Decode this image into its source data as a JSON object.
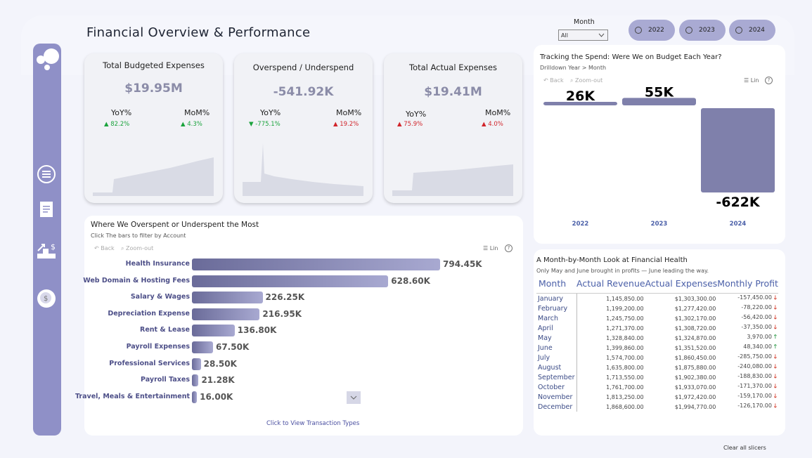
{
  "page_title": "Financial Overview & Performance",
  "month_slicer": {
    "label": "Month",
    "value": "All"
  },
  "year_buttons": [
    "2022",
    "2023",
    "2024"
  ],
  "kpis": [
    {
      "title": "Total Budgeted Expenses",
      "value": "$19.95M",
      "yoy_label": "YoY%",
      "yoy": "▲ 82.2%",
      "mom_label": "MoM%",
      "mom": "▲ 4.3%"
    },
    {
      "title": "Overspend / Underspend",
      "value": "-541.92K",
      "yoy_label": "YoY%",
      "yoy": "▼ -775.1%",
      "mom_label": "MoM%",
      "mom": "▲ 19.2%"
    },
    {
      "title": "Total Actual Expenses",
      "value": "$19.41M",
      "yoy_label": "YoY%",
      "yoy": "▲ 75.9%",
      "mom_label": "MoM%",
      "mom": "▲ 4.0%"
    }
  ],
  "budget_chart": {
    "title": "Tracking the Spend: Were We on Budget Each Year?",
    "breadcrumb": "Drilldown Year > Month",
    "back": "Back",
    "zoom_out": "Zoom-out",
    "lin": "Lin"
  },
  "overspend_chart": {
    "title": "Where We Overspent or Underspent the Most",
    "subtitle": "Click The bars to filter by Account",
    "back": "Back",
    "zoom_out": "Zoom-out",
    "lin": "Lin",
    "footer_link": "Click to View Transaction Types"
  },
  "month_table": {
    "title": "A Month-by-Month Look at Financial Health",
    "subtitle": "Only May and June brought in profits — June leading the way.",
    "columns": [
      "Month",
      "Actual Revenue",
      "Actual Expenses",
      "Monthly Profit"
    ],
    "rows": [
      {
        "month": "January",
        "revenue": "1,145,850.00",
        "expenses": "$1,303,300.00",
        "profit": "-157,450.00",
        "dir": "down"
      },
      {
        "month": "February",
        "revenue": "1,199,200.00",
        "expenses": "$1,277,420.00",
        "profit": "-78,220.00",
        "dir": "down"
      },
      {
        "month": "March",
        "revenue": "1,245,750.00",
        "expenses": "$1,302,170.00",
        "profit": "-56,420.00",
        "dir": "down"
      },
      {
        "month": "April",
        "revenue": "1,271,370.00",
        "expenses": "$1,308,720.00",
        "profit": "-37,350.00",
        "dir": "down"
      },
      {
        "month": "May",
        "revenue": "1,328,840.00",
        "expenses": "$1,324,870.00",
        "profit": "3,970.00",
        "dir": "up"
      },
      {
        "month": "June",
        "revenue": "1,399,860.00",
        "expenses": "$1,351,520.00",
        "profit": "48,340.00",
        "dir": "up"
      },
      {
        "month": "July",
        "revenue": "1,574,700.00",
        "expenses": "$1,860,450.00",
        "profit": "-285,750.00",
        "dir": "down"
      },
      {
        "month": "August",
        "revenue": "1,635,800.00",
        "expenses": "$1,875,880.00",
        "profit": "-240,080.00",
        "dir": "down"
      },
      {
        "month": "September",
        "revenue": "1,713,550.00",
        "expenses": "$1,902,380.00",
        "profit": "-188,830.00",
        "dir": "down"
      },
      {
        "month": "October",
        "revenue": "1,761,700.00",
        "expenses": "$1,933,070.00",
        "profit": "-171,370.00",
        "dir": "down"
      },
      {
        "month": "November",
        "revenue": "1,813,250.00",
        "expenses": "$1,972,420.00",
        "profit": "-159,170.00",
        "dir": "down"
      },
      {
        "month": "December",
        "revenue": "1,868,600.00",
        "expenses": "$1,994,770.00",
        "profit": "-126,170.00",
        "dir": "down"
      }
    ]
  },
  "clear_slicers": "Clear all slicers",
  "colors": {
    "accent": "#8f90c7",
    "bar_dark": "#6a6b99",
    "bar_light": "#a8a9d1",
    "up": "#2f9a4a",
    "down": "#d23a2a"
  },
  "chart_data": [
    {
      "type": "bar",
      "title": "Tracking the Spend: Were We on Budget Each Year?",
      "categories": [
        "2022",
        "2023",
        "2024"
      ],
      "values": [
        26000,
        55000,
        -622000
      ],
      "data_labels": [
        "26K",
        "55K",
        "-622K"
      ]
    },
    {
      "type": "bar",
      "orientation": "horizontal",
      "title": "Where We Overspent or Underspent the Most",
      "categories": [
        "Health Insurance",
        "Web Domain & Hosting Fees",
        "Salary & Wages",
        "Depreciation Expense",
        "Rent & Lease",
        "Payroll Expenses",
        "Professional Services",
        "Payroll Taxes",
        "Travel, Meals & Entertainment"
      ],
      "values": [
        794450,
        628600,
        226250,
        216950,
        136800,
        67500,
        28500,
        21280,
        16000
      ],
      "data_labels": [
        "794.45K",
        "628.60K",
        "226.25K",
        "216.95K",
        "136.80K",
        "67.50K",
        "28.50K",
        "21.28K",
        "16.00K"
      ]
    }
  ]
}
